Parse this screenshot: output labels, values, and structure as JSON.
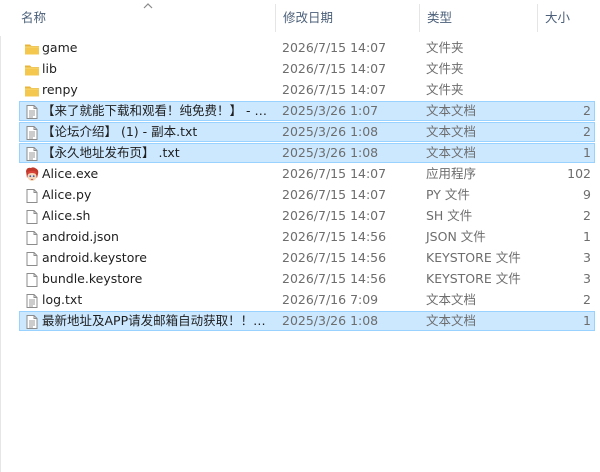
{
  "columns": {
    "name": "名称",
    "date": "修改日期",
    "type": "类型",
    "size": "大小"
  },
  "files": [
    {
      "name": "game",
      "date": "2026/7/15 14:07",
      "type": "文件夹",
      "size": "",
      "icon": "folder-icon",
      "selected": false
    },
    {
      "name": "lib",
      "date": "2026/7/15 14:07",
      "type": "文件夹",
      "size": "",
      "icon": "folder-icon",
      "selected": false
    },
    {
      "name": "renpy",
      "date": "2026/7/15 14:07",
      "type": "文件夹",
      "size": "",
      "icon": "folder-icon",
      "selected": false
    },
    {
      "name": "【来了就能下载和观看！纯免费！】 - 副本.txt",
      "date": "2025/3/26 1:07",
      "type": "文本文档",
      "size": "2",
      "icon": "text-document-icon",
      "selected": true
    },
    {
      "name": "【论坛介绍】 (1) - 副本.txt",
      "date": "2025/3/26 1:08",
      "type": "文本文档",
      "size": "2",
      "icon": "text-document-icon",
      "selected": true
    },
    {
      "name": "【永久地址发布页】 .txt",
      "date": "2025/3/26 1:08",
      "type": "文本文档",
      "size": "1",
      "icon": "text-document-icon",
      "selected": true
    },
    {
      "name": "Alice.exe",
      "date": "2026/7/15 14:07",
      "type": "应用程序",
      "size": "102",
      "icon": "renpy-app-icon",
      "selected": false
    },
    {
      "name": "Alice.py",
      "date": "2026/7/15 14:07",
      "type": "PY 文件",
      "size": "9",
      "icon": "file-icon",
      "selected": false
    },
    {
      "name": "Alice.sh",
      "date": "2026/7/15 14:07",
      "type": "SH 文件",
      "size": "2",
      "icon": "file-icon",
      "selected": false
    },
    {
      "name": "android.json",
      "date": "2026/7/15 14:56",
      "type": "JSON 文件",
      "size": "1",
      "icon": "file-icon",
      "selected": false
    },
    {
      "name": "android.keystore",
      "date": "2026/7/15 14:56",
      "type": "KEYSTORE 文件",
      "size": "3",
      "icon": "file-icon",
      "selected": false
    },
    {
      "name": "bundle.keystore",
      "date": "2026/7/15 14:56",
      "type": "KEYSTORE 文件",
      "size": "3",
      "icon": "file-icon",
      "selected": false
    },
    {
      "name": "log.txt",
      "date": "2026/7/16 7:09",
      "type": "文本文档",
      "size": "2",
      "icon": "text-document-icon",
      "selected": false
    },
    {
      "name": "最新地址及APP请发邮箱自动获取！！！.txt",
      "date": "2025/3/26 1:08",
      "type": "文本文档",
      "size": "1",
      "icon": "text-document-icon",
      "selected": true
    }
  ],
  "colors": {
    "selection_fill": "#cce8ff",
    "selection_border": "#99d1ff",
    "header_text": "#4c607a",
    "folder": "#f4c84e"
  }
}
